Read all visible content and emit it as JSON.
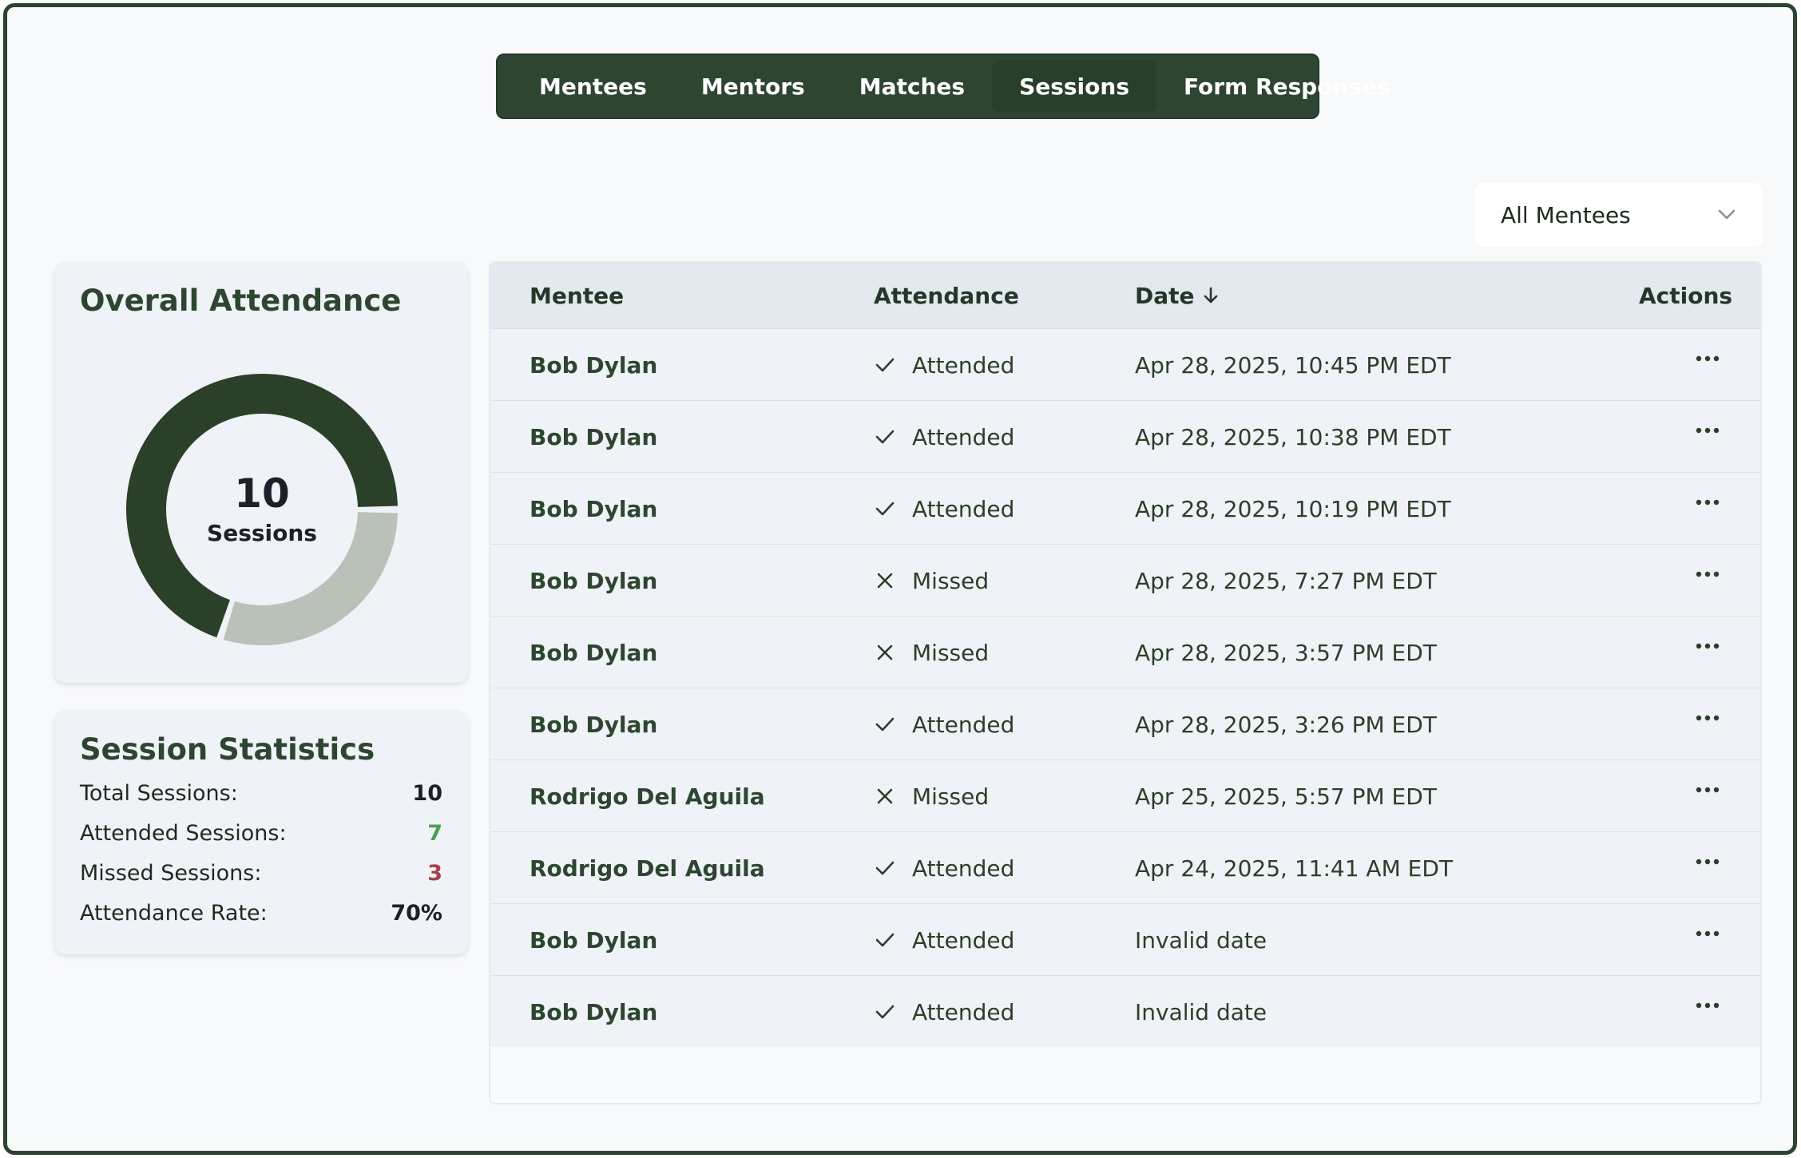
{
  "tabs": [
    {
      "label": "Mentees",
      "active": false
    },
    {
      "label": "Mentors",
      "active": false
    },
    {
      "label": "Matches",
      "active": false
    },
    {
      "label": "Sessions",
      "active": true
    },
    {
      "label": "Form Responses",
      "active": false
    }
  ],
  "filter": {
    "selected": "All Mentees",
    "icon": "chevron-down-icon"
  },
  "attendance_card": {
    "title": "Overall Attendance",
    "total": "10",
    "total_label": "Sessions",
    "attended_fraction": 0.7,
    "colors": {
      "attended": "#2a4029",
      "missed": "#b9c1b9"
    }
  },
  "stats_card": {
    "title": "Session Statistics",
    "rows": [
      {
        "label": "Total Sessions:",
        "value": "10",
        "color": "#1d1f2a"
      },
      {
        "label": "Attended Sessions:",
        "value": "7",
        "color": "#4f9d55"
      },
      {
        "label": "Missed Sessions:",
        "value": "3",
        "color": "#a3434f"
      },
      {
        "label": "Attendance Rate:",
        "value": "70%",
        "color": "#1d1f2a"
      }
    ]
  },
  "table": {
    "headers": {
      "mentee": "Mentee",
      "attendance": "Attendance",
      "date": "Date",
      "actions": "Actions"
    },
    "sort_icon": "arrow-down-icon",
    "rows": [
      {
        "mentee": "Bob Dylan",
        "status": "Attended",
        "date": "Apr 28, 2025, 10:45 PM EDT"
      },
      {
        "mentee": "Bob Dylan",
        "status": "Attended",
        "date": "Apr 28, 2025, 10:38 PM EDT"
      },
      {
        "mentee": "Bob Dylan",
        "status": "Attended",
        "date": "Apr 28, 2025, 10:19 PM EDT"
      },
      {
        "mentee": "Bob Dylan",
        "status": "Missed",
        "date": "Apr 28, 2025, 7:27 PM EDT"
      },
      {
        "mentee": "Bob Dylan",
        "status": "Missed",
        "date": "Apr 28, 2025, 3:57 PM EDT"
      },
      {
        "mentee": "Bob Dylan",
        "status": "Attended",
        "date": "Apr 28, 2025, 3:26 PM EDT"
      },
      {
        "mentee": "Rodrigo Del Aguila",
        "status": "Missed",
        "date": "Apr 25, 2025, 5:57 PM EDT"
      },
      {
        "mentee": "Rodrigo Del Aguila",
        "status": "Attended",
        "date": "Apr 24, 2025, 11:41 AM EDT"
      },
      {
        "mentee": "Bob Dylan",
        "status": "Attended",
        "date": "Invalid date"
      },
      {
        "mentee": "Bob Dylan",
        "status": "Attended",
        "date": "Invalid date"
      }
    ]
  }
}
